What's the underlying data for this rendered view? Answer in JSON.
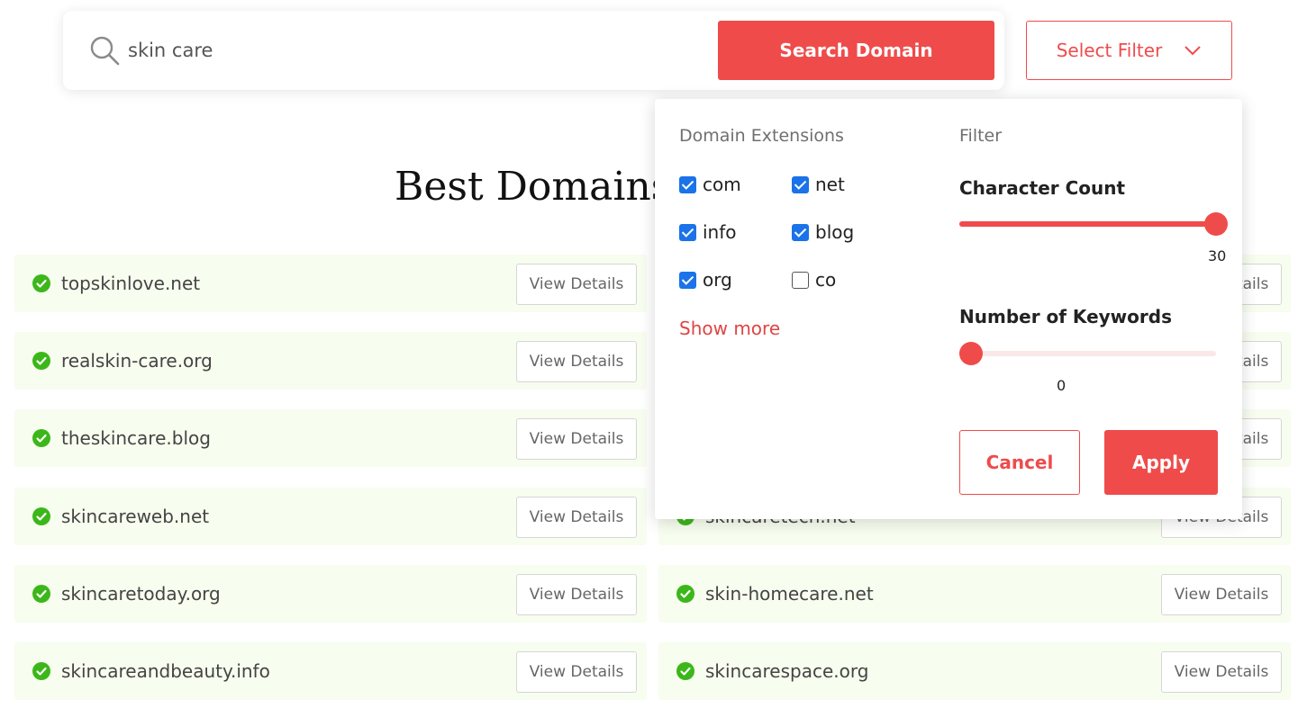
{
  "search": {
    "value": "skin care",
    "button_label": "Search Domain",
    "filter_label": "Select Filter"
  },
  "headline": "Best Domains",
  "colors": {
    "accent": "#ef4b4b",
    "row_bg": "#f7fdef",
    "check_green": "#3cb71a",
    "checkbox_blue": "#1a73e8"
  },
  "view_details_label": "View Details",
  "rows_left": [
    "topskinlove.net",
    "realskin-care.org",
    "theskincare.blog",
    "skincareweb.net",
    "skincaretoday.org",
    "skincareandbeauty.info"
  ],
  "rows_right": [
    "",
    "",
    "",
    "skincaretech.net",
    "skin-homecare.net",
    "skincarespace.org"
  ],
  "filter_panel": {
    "extensions_title": "Domain Extensions",
    "filter_title": "Filter",
    "extensions": [
      {
        "label": "com",
        "checked": true
      },
      {
        "label": "net",
        "checked": true
      },
      {
        "label": "info",
        "checked": true
      },
      {
        "label": "blog",
        "checked": true
      },
      {
        "label": "org",
        "checked": true
      },
      {
        "label": "co",
        "checked": false
      }
    ],
    "show_more": "Show more",
    "character_count": {
      "label": "Character Count",
      "value": "30",
      "fraction": 1.0
    },
    "keywords": {
      "label": "Number of Keywords",
      "value": "0",
      "fraction": 0.0
    },
    "cancel_label": "Cancel",
    "apply_label": "Apply"
  }
}
